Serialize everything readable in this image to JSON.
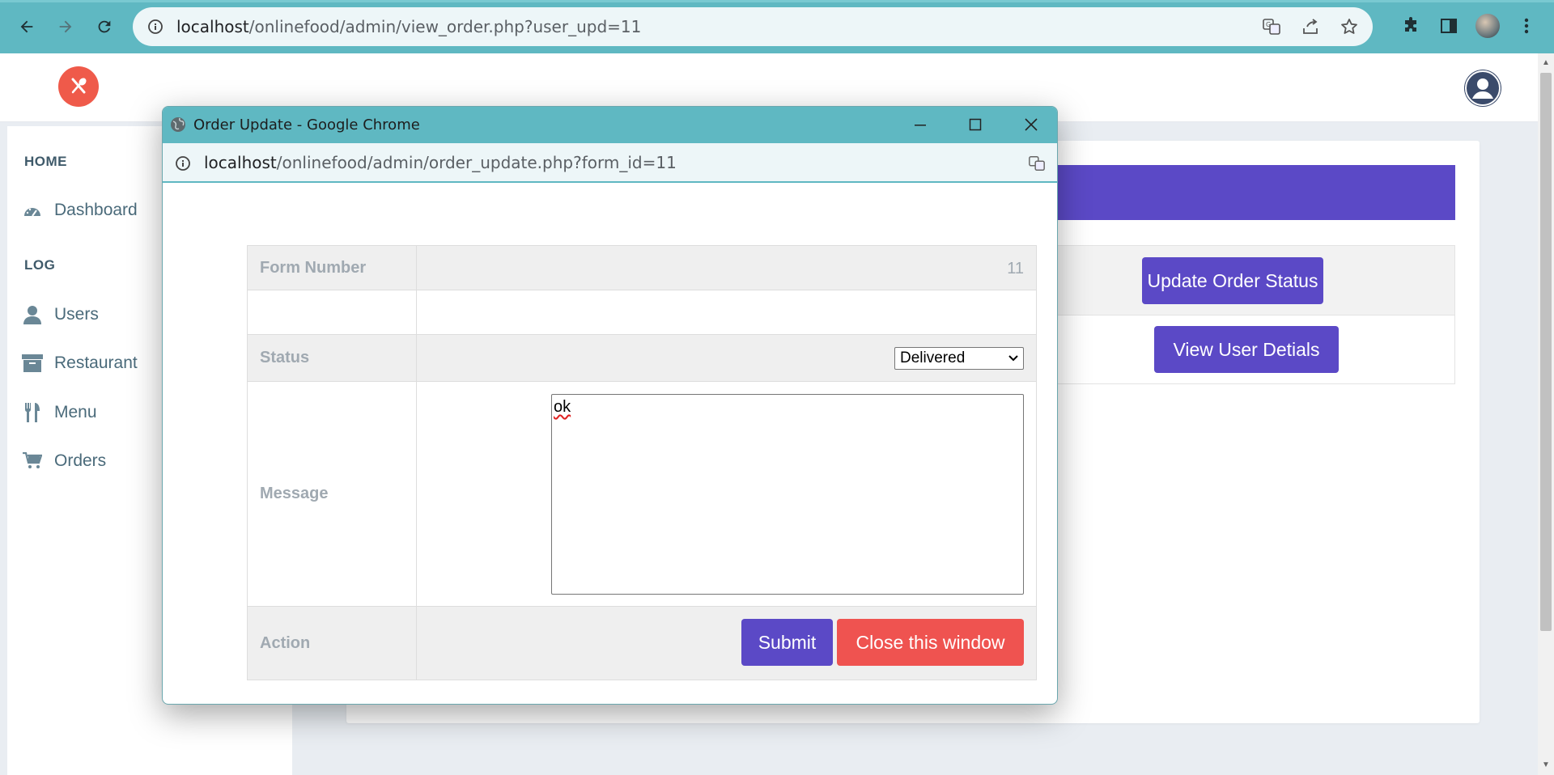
{
  "browser": {
    "url_host": "localhost",
    "url_path": "/onlinefood/admin/view_order.php?user_upd=11"
  },
  "sidebar": {
    "sections": [
      {
        "heading": "HOME"
      },
      {
        "heading": "LOG"
      }
    ],
    "items": [
      {
        "label": "Dashboard",
        "icon": "dashboard-icon"
      },
      {
        "label": "Users",
        "icon": "user-icon"
      },
      {
        "label": "Restaurant",
        "icon": "archive-icon"
      },
      {
        "label": "Menu",
        "icon": "cutlery-icon"
      },
      {
        "label": "Orders",
        "icon": "cart-icon"
      }
    ]
  },
  "main": {
    "buttons": {
      "update_status": "Update Order Status",
      "view_user": "View User Detials"
    }
  },
  "popup": {
    "window_title": "Order Update - Google Chrome",
    "url_host": "localhost",
    "url_path": "/onlinefood/admin/order_update.php?form_id=11",
    "form": {
      "form_number_label": "Form Number",
      "form_number_value": "11",
      "status_label": "Status",
      "status_value": "Delivered",
      "message_label": "Message",
      "message_value": "ok",
      "action_label": "Action",
      "submit_label": "Submit",
      "close_label": "Close this window"
    }
  },
  "colors": {
    "chrome_teal": "#5fb8c2",
    "accent_purple": "#5b49c6",
    "danger_red": "#ef5350",
    "logo_orange": "#ef5a4a"
  }
}
